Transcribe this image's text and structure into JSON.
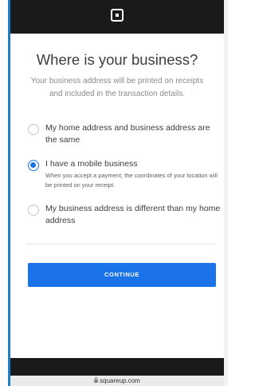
{
  "page": {
    "title": "Where is your business?",
    "subtitle": "Your business address will be printed on receipts and included in the transaction details."
  },
  "options": [
    {
      "label": "My home address and business address are the same",
      "selected": false
    },
    {
      "label": "I have a mobile business",
      "description": "When you accept a payment, the coordinates of your location will be printed on your receipt.",
      "selected": true
    },
    {
      "label": "My business address is different than my home address",
      "selected": false
    }
  ],
  "actions": {
    "continue_label": "CONTINUE"
  },
  "browser": {
    "url": "squareup.com"
  },
  "colors": {
    "accent": "#1a73e8",
    "topbar": "#1a1a1a"
  },
  "icons": {
    "logo": "square-logo-icon",
    "lock": "lock-icon"
  }
}
